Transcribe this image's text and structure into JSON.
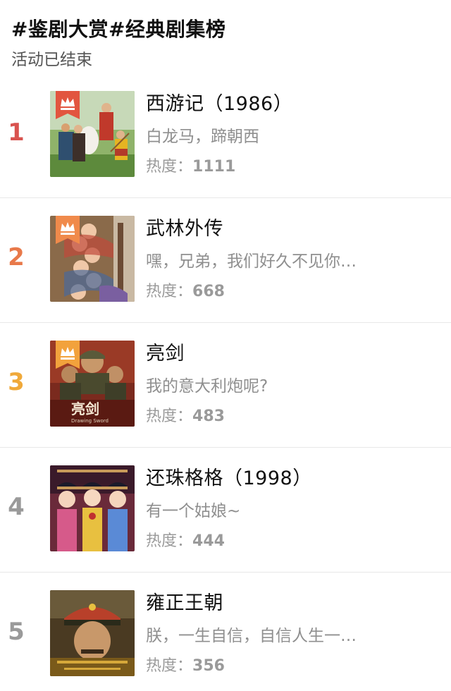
{
  "header": {
    "title": "#鉴剧大赏#经典剧集榜",
    "status": "活动已结束"
  },
  "colors": {
    "rank1": "#d9534f",
    "rank2": "#e8794a",
    "rank3": "#f0a93a",
    "rank_other": "#9a9a9a",
    "badge_gold": "#f2a23c",
    "badge_red": "#e2553f"
  },
  "list": [
    {
      "rank": "1",
      "title": "西游记（1986）",
      "desc": "白龙马，蹄朝西",
      "heat_label": "热度：",
      "heat_value": "1111"
    },
    {
      "rank": "2",
      "title": "武林外传",
      "desc": "嘿，兄弟，我们好久不见你…",
      "heat_label": "热度：",
      "heat_value": "668"
    },
    {
      "rank": "3",
      "title": "亮剑",
      "desc": "我的意大利炮呢?",
      "heat_label": "热度：",
      "heat_value": "483"
    },
    {
      "rank": "4",
      "title": "还珠格格（1998）",
      "desc": "有一个姑娘~",
      "heat_label": "热度：",
      "heat_value": "444"
    },
    {
      "rank": "5",
      "title": "雍正王朝",
      "desc": "朕，一生自信，自信人生一…",
      "heat_label": "热度：",
      "heat_value": "356"
    }
  ],
  "icons": {
    "crown": "crown-icon"
  }
}
